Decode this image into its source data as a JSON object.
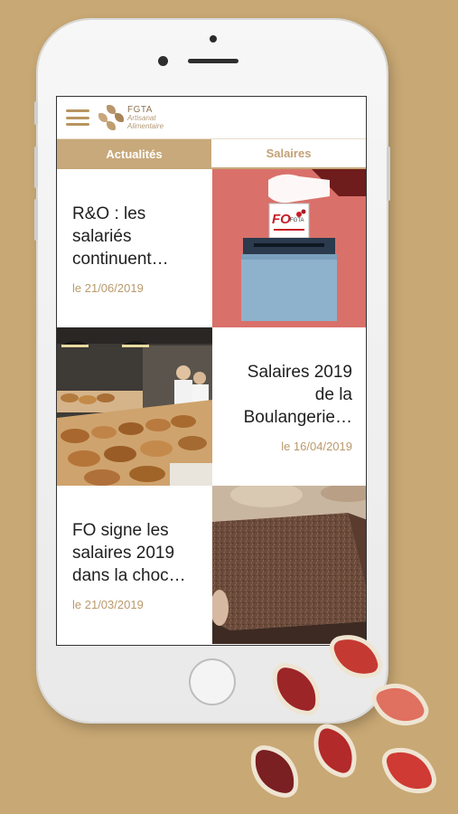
{
  "app": {
    "logo": {
      "line1": "FGTA",
      "line2": "Artisanat",
      "line3": "Alimentaire"
    },
    "brand_color": "#c8a97b"
  },
  "header": {
    "menu_icon": "hamburger-menu-icon"
  },
  "tabs": [
    {
      "label": "Actualités",
      "active": true
    },
    {
      "label": "Salaires",
      "active": false
    }
  ],
  "articles": [
    {
      "title_lines": [
        "R&O : les",
        "salariés",
        "continuent…"
      ],
      "date": "le 21/06/2019",
      "image": "ballot-box-fo-illustration"
    },
    {
      "title_lines": [
        "Salaires 2019",
        "de la",
        "Boulangerie…"
      ],
      "date": "le 16/04/2019",
      "image": "bakery-shop-photo"
    },
    {
      "title_lines": [
        "FO signe les",
        "salaires 2019",
        "dans la choc…"
      ],
      "date": "le 21/03/2019",
      "image": "chocolate-slab-photo"
    }
  ],
  "ballot_label": {
    "brand": "FO",
    "org": "FGTA"
  }
}
